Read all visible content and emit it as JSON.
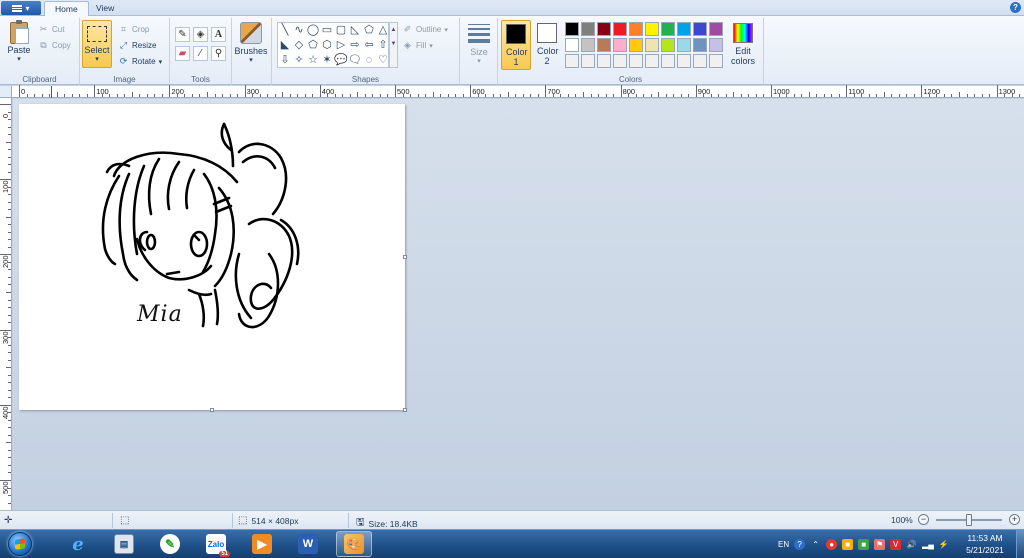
{
  "tabs": {
    "menu_glyph": "▾",
    "home": "Home",
    "view": "View",
    "help": "?"
  },
  "clipboard": {
    "label": "Clipboard",
    "paste": "Paste",
    "cut": "Cut",
    "copy": "Copy"
  },
  "image": {
    "label": "Image",
    "select": "Select",
    "crop": "Crop",
    "resize": "Resize",
    "rotate": "Rotate"
  },
  "tools": {
    "label": "Tools"
  },
  "brushes": {
    "label": "Brushes"
  },
  "shapes": {
    "label": "Shapes",
    "outline": "Outline",
    "fill": "Fill",
    "items": [
      "╲",
      "∿",
      "◯",
      "▭",
      "▢",
      "◺",
      "⬠",
      "△",
      "◣",
      "◇",
      "⬠",
      "⬡",
      "▷",
      "⇨",
      "⇦",
      "⇧",
      "⇩",
      "✧",
      "☆",
      "✶",
      "💬",
      "🗨",
      "◌",
      "♡"
    ]
  },
  "size": {
    "label": "Size"
  },
  "colors": {
    "label": "Colors",
    "color1": "Color 1",
    "color2": "Color 2",
    "color1_value": "#000000",
    "color2_value": "#ffffff",
    "edit": "Edit colors",
    "palette": [
      "#000000",
      "#7f7f7f",
      "#880015",
      "#ed1c24",
      "#ff7f27",
      "#fff200",
      "#22b14c",
      "#00a2e8",
      "#3f48cc",
      "#a349a4",
      "#ffffff",
      "#c3c3c3",
      "#b97a57",
      "#ffaec9",
      "#ffc90e",
      "#efe4b0",
      "#b5e61d",
      "#99d9ea",
      "#7092be",
      "#c8bfe7",
      "#f0f0f0",
      "#f0f0f0",
      "#f0f0f0",
      "#f0f0f0",
      "#f0f0f0",
      "#f0f0f0",
      "#f0f0f0",
      "#f0f0f0",
      "#f0f0f0",
      "#f0f0f0"
    ]
  },
  "ruler": {
    "h_labels": [
      "0",
      "100",
      "200",
      "300",
      "400",
      "500",
      "600",
      "700",
      "800",
      "900",
      "1000",
      "1100",
      "1200",
      "1300"
    ],
    "v_labels": [
      "0",
      "100",
      "200",
      "300",
      "400",
      "500"
    ]
  },
  "drawing": {
    "signature": "Mia"
  },
  "status": {
    "dimensions": "514 × 408px",
    "size": "Size: 18.4KB",
    "zoom": "100%"
  },
  "taskbar": {
    "apps": [
      "internet-explorer",
      "scanner",
      "greenshot",
      "zalo",
      "media-player",
      "word",
      "paint"
    ],
    "zalo_label": "Zalo",
    "zalo_badge": "51",
    "word_label": "W",
    "tray_lang": "EN",
    "time": "11:53 AM",
    "date": "5/21/2021"
  }
}
